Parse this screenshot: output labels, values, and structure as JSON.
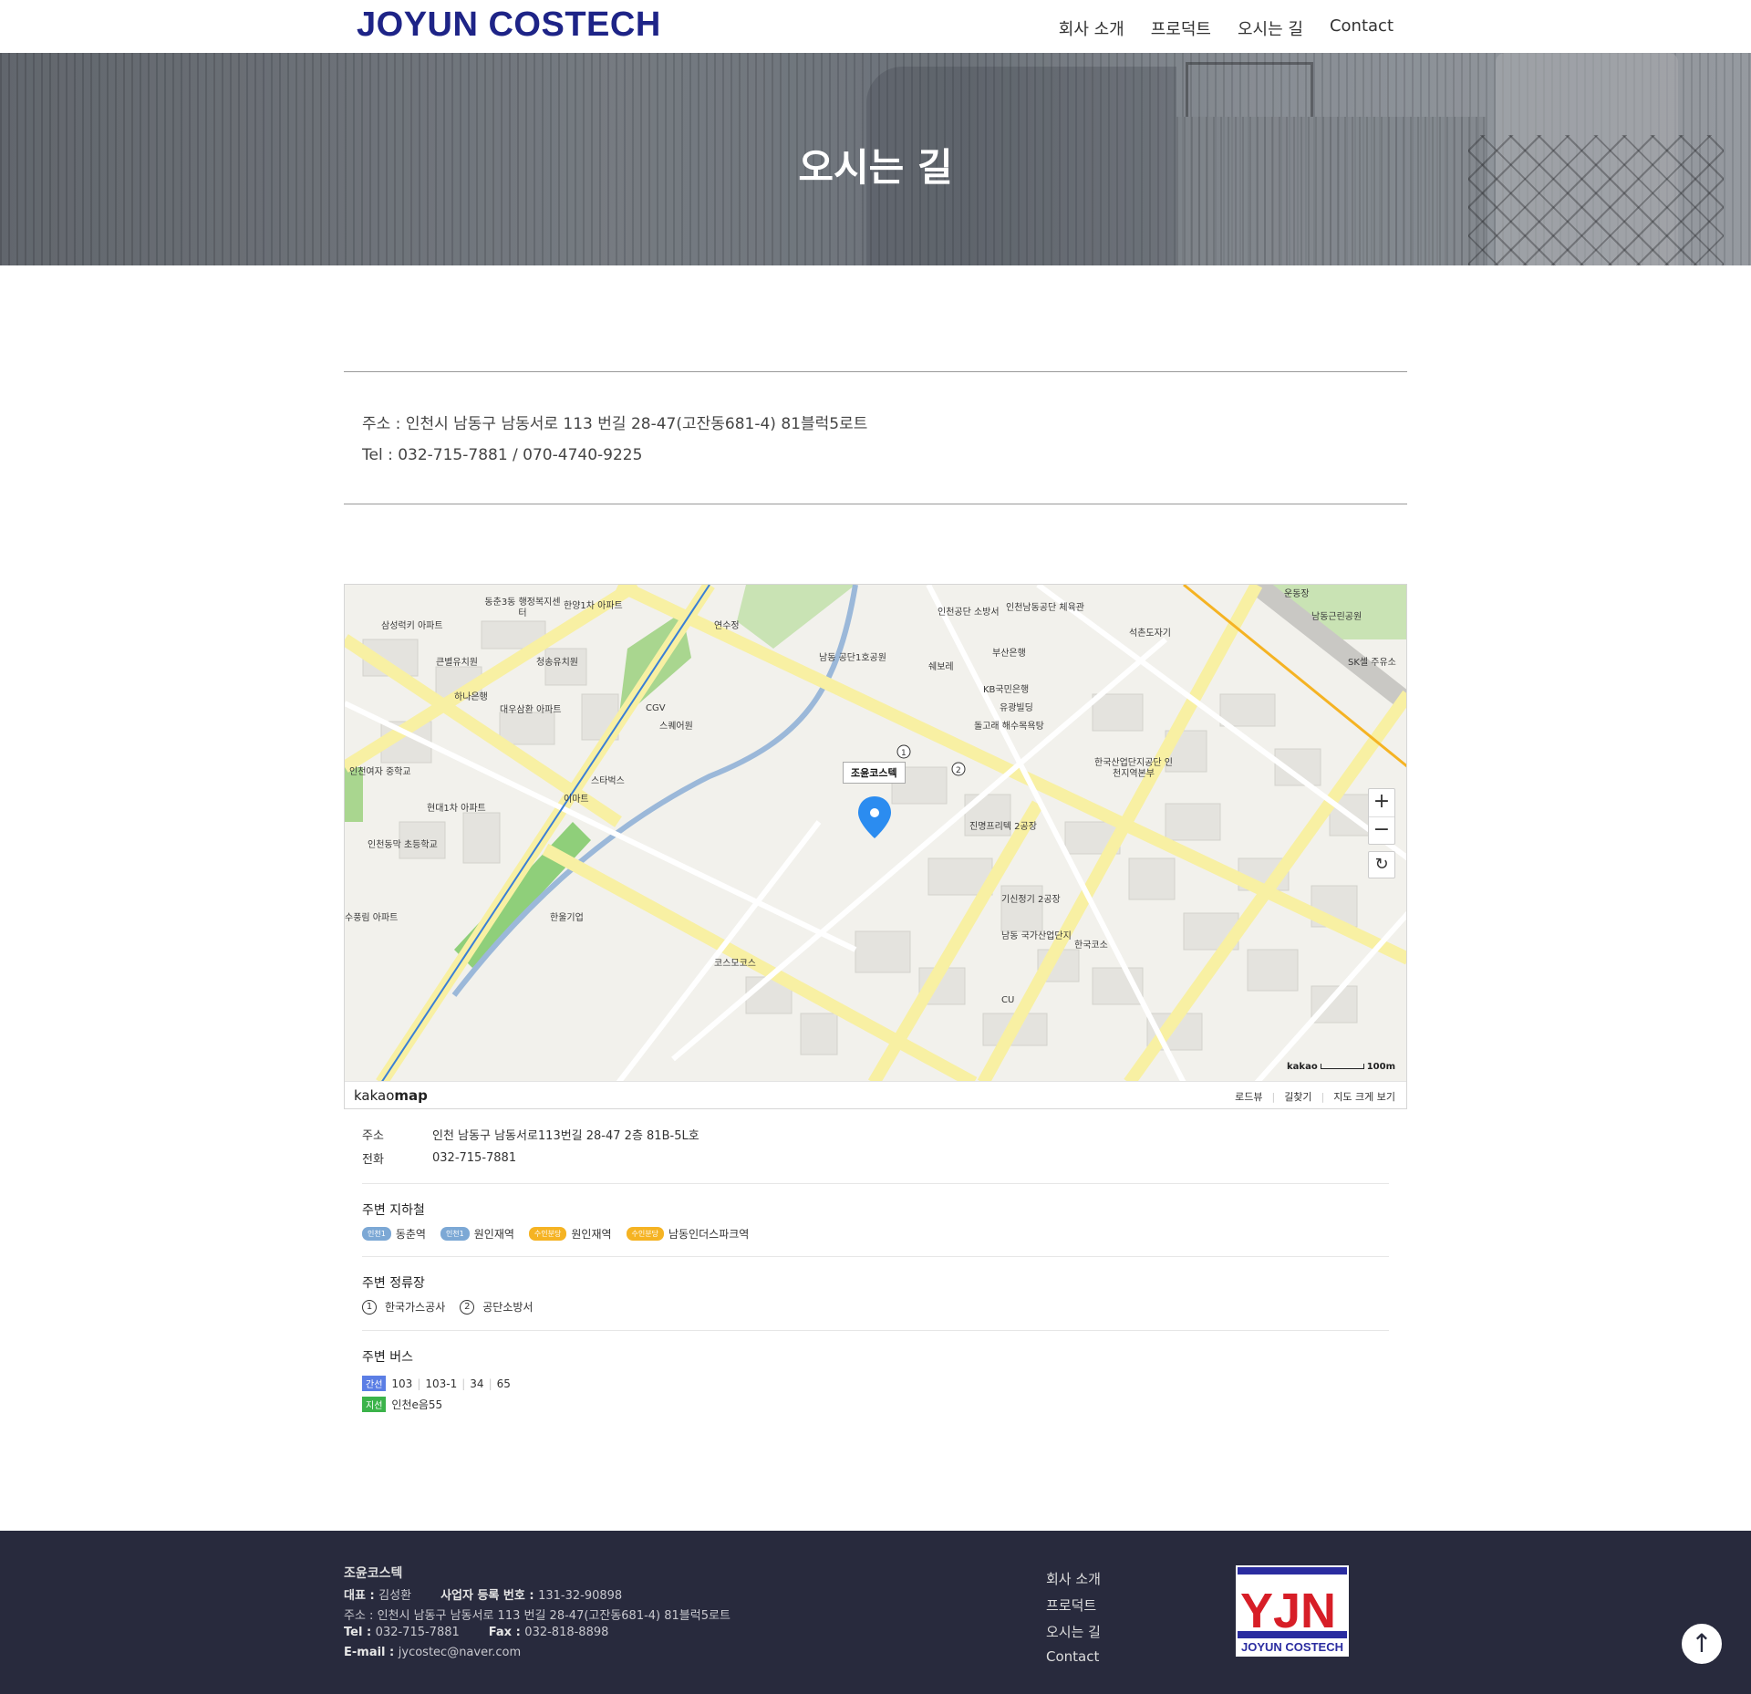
{
  "header": {
    "logo": "JOYUN COSTECH",
    "nav": [
      "회사 소개",
      "프로덕트",
      "오시는 길",
      "Contact"
    ]
  },
  "hero": {
    "title": "오시는 길"
  },
  "address_block": {
    "address": "주소 : 인천시 남동구 남동서로 113 번길 28-47(고잔동681-4) 81블럭5로트",
    "tel": "Tel : 032-715-7881 / 070-4740-9225"
  },
  "map": {
    "pin_label": "조윤코스텍",
    "labels": [
      "동춘3동 행정복지센터",
      "한양1차 아파트",
      "삼성럭키 아파트",
      "큰별유치원",
      "청송유치원",
      "하나은행",
      "대우삼환 아파트",
      "인천여자 중학교",
      "현대1차 아파트",
      "인천동막 초등학교",
      "수풍림 아파트",
      "CGV",
      "스퀘어원",
      "스타벅스",
      "이마트",
      "연수정",
      "남동 공단1호공원",
      "인천공단 소방서",
      "인천남동공단 체육관",
      "운동장",
      "남동근린공원",
      "부산은행",
      "쉐보레",
      "KB국민은행",
      "유광빌딩",
      "돌고래 해수목욕탕",
      "한국산업단지공단 인천지역본부",
      "진명프리텍 2공장",
      "기신정기 2공장",
      "남동 국가산업단지",
      "한국코소",
      "석촌도자기",
      "한울기업",
      "코스모코스",
      "CU",
      "SK셀 주유소"
    ],
    "brand_prefix": "kakao",
    "brand_suffix": "map",
    "scale_brand": "kakao",
    "scale": "100m",
    "links": [
      "로드뷰",
      "길찾기",
      "지도 크게 보기"
    ],
    "zoom_in": "+",
    "zoom_out": "−",
    "refresh": "↻"
  },
  "place_info": {
    "address_label": "주소",
    "address": "인천 남동구 남동서로113번길 28-47 2층 81B-5L호",
    "phone_label": "전화",
    "phone": "032-715-7881",
    "subway_title": "주변 지하철",
    "subway": [
      {
        "line": "인천1",
        "color": "#7ca8d5",
        "name": "동춘역"
      },
      {
        "line": "인천1",
        "color": "#7ca8d5",
        "name": "원인재역"
      },
      {
        "line": "수인분당",
        "color": "#f5b323",
        "name": "원인재역"
      },
      {
        "line": "수인분당",
        "color": "#f5b323",
        "name": "남동인더스파크역"
      }
    ],
    "stops_title": "주변 정류장",
    "stops": [
      {
        "no": "1",
        "name": "한국가스공사"
      },
      {
        "no": "2",
        "name": "공단소방서"
      }
    ],
    "bus_title": "주변 버스",
    "buses": [
      {
        "type": "간선",
        "color": "#5b7ee5",
        "numbers": [
          "103",
          "103-1",
          "34",
          "65"
        ]
      },
      {
        "type": "지선",
        "color": "#3bb34a",
        "numbers": [
          "인천e음55"
        ]
      }
    ]
  },
  "footer": {
    "company": "조윤코스텍",
    "ceo_label": "대표 : ",
    "ceo": "김성환",
    "biz_label": "사업자 등록 번호 : ",
    "biz": "131-32-90898",
    "address": "주소 : 인천시 남동구 남동서로 113 번길 28-47(고잔동681-4) 81블럭5로트",
    "tel_label": "Tel : ",
    "tel": "032-715-7881",
    "fax_label": "Fax : ",
    "fax": "032-818-8898",
    "email_label": "E-mail : ",
    "email": "jycostec@naver.com",
    "nav": [
      "회사 소개",
      "프로덕트",
      "오시는 길",
      "Contact"
    ],
    "logo_letters": "YJN",
    "logo_text": "JOYUN COSTECH"
  },
  "colors": {
    "brand": "#1e2487",
    "footer_bg": "#282a3d",
    "pin": "#2b8cf0"
  }
}
